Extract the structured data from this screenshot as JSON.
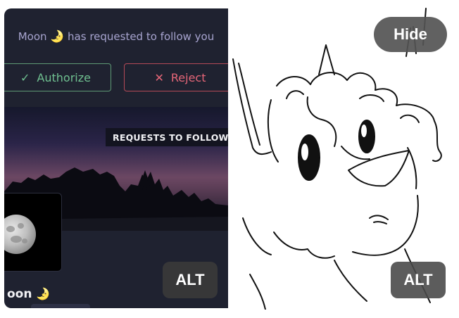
{
  "follow_request": {
    "requester": "Moon",
    "moon_emoji": "🌛",
    "message": "has requested to follow you",
    "authorize_label": "Authorize",
    "reject_label": "Reject"
  },
  "banner": {
    "tag": "REQUESTS TO FOLLOW Y"
  },
  "profile": {
    "name_partial": "oon",
    "emoji": "🌛"
  },
  "badges": {
    "alt_left": "ALT",
    "alt_right": "ALT",
    "hide": "Hide"
  },
  "icons": {
    "check": "✓",
    "cross": "✕"
  },
  "colors": {
    "panel_bg": "#1f2230",
    "authorize": "#6fc090",
    "reject": "#e66678",
    "notice_text": "#a7a4cf"
  }
}
